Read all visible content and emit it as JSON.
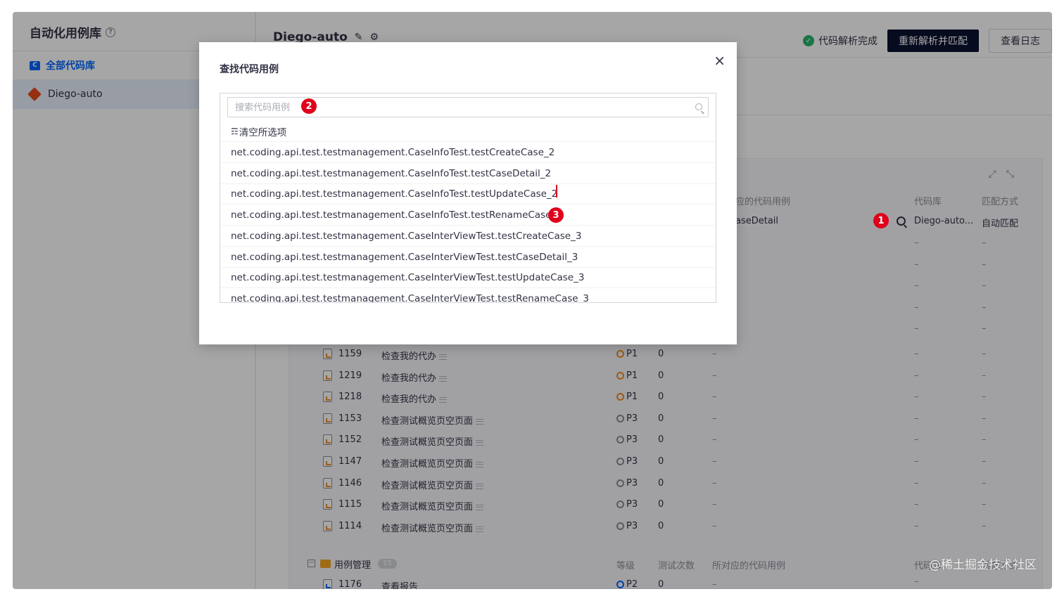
{
  "sidebar": {
    "title": "自动化用例库",
    "all_repos": "全部代码库",
    "repo_icon": "C",
    "repo_item": "Diego-auto"
  },
  "header": {
    "repo_title": "Diego-auto",
    "status": "代码解析完成",
    "reparse_button": "重新解析并匹配",
    "log_button": "查看日志"
  },
  "table": {
    "col_code_case": "应的代码用例",
    "col_repo": "代码库",
    "col_match": "匹配方式",
    "first_row": {
      "code_case": "aseDetail",
      "repo": "Diego-auto...",
      "match": "自动匹配"
    },
    "empty_dash": "–",
    "rows": [
      {
        "id": "1159",
        "title": "检查我的代办",
        "priority": "P1",
        "count": "0"
      },
      {
        "id": "1219",
        "title": "检查我的代办",
        "priority": "P1",
        "count": "0"
      },
      {
        "id": "1218",
        "title": "检查我的代办",
        "priority": "P1",
        "count": "0"
      },
      {
        "id": "1153",
        "title": "检查测试概览页空页面",
        "priority": "P3",
        "count": "0"
      },
      {
        "id": "1152",
        "title": "检查测试概览页空页面",
        "priority": "P3",
        "count": "0"
      },
      {
        "id": "1147",
        "title": "检查测试概览页空页面",
        "priority": "P3",
        "count": "0"
      },
      {
        "id": "1146",
        "title": "检查测试概览页空页面",
        "priority": "P3",
        "count": "0"
      },
      {
        "id": "1115",
        "title": "检查测试概览页空页面",
        "priority": "P3",
        "count": "0"
      },
      {
        "id": "1114",
        "title": "检查测试概览页空页面",
        "priority": "P3",
        "count": "0"
      }
    ],
    "group": {
      "name": "用例管理",
      "count": "15",
      "col_level": "等级",
      "col_tests": "测试次数",
      "col_code_case": "所对应的代码用例",
      "col_repo": "代码库",
      "col_match": "匹配方式"
    },
    "last_row": {
      "id": "1176",
      "title": "查看报告",
      "priority": "P2",
      "count": "0"
    }
  },
  "modal": {
    "title": "查找代码用例",
    "close": "×",
    "search_placeholder": "搜索代码用例",
    "clear_all": "清空所选项",
    "options": [
      "net.coding.api.test.testmanagement.CaseInfoTest.testCreateCase_2",
      "net.coding.api.test.testmanagement.CaseInfoTest.testCaseDetail_2",
      "net.coding.api.test.testmanagement.CaseInfoTest.testUpdateCase_2",
      "net.coding.api.test.testmanagement.CaseInfoTest.testRenameCase_2",
      "net.coding.api.test.testmanagement.CaseInterViewTest.testCreateCase_3",
      "net.coding.api.test.testmanagement.CaseInterViewTest.testCaseDetail_3",
      "net.coding.api.test.testmanagement.CaseInterViewTest.testUpdateCase_3",
      "net.coding.api.test.testmanagement.CaseInterViewTest.testRenameCase_3"
    ]
  },
  "annotations": {
    "badge_1": "1",
    "badge_2": "2",
    "badge_3": "3"
  },
  "watermark": "@稀土掘金技术社区",
  "colors": {
    "accent": "#0066ff",
    "badge": "#e0001b",
    "ok": "#29b36c",
    "p1": "#f08a24"
  }
}
